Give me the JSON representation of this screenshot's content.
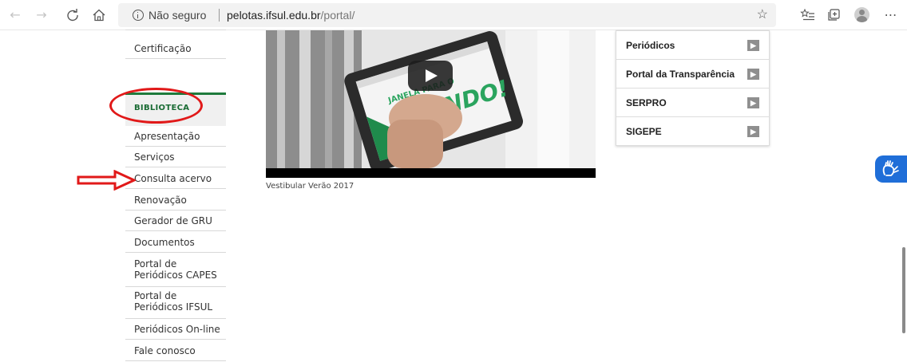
{
  "browser": {
    "security_label": "Não seguro",
    "url_host": "pelotas.ifsul.edu.br",
    "url_path": "/portal/",
    "icons": [
      "back-icon",
      "forward-icon",
      "refresh-icon",
      "home-icon",
      "info-icon",
      "favorite-star-icon",
      "favorites-list-icon",
      "collections-icon",
      "profile-icon",
      "more-icon"
    ]
  },
  "left_menu": {
    "top_items": [
      "Certificação"
    ],
    "section_title": "BIBLIOTECA",
    "items": [
      "Apresentação",
      "Serviços",
      "Consulta acervo",
      "Renovação",
      "Gerador de GRU",
      "Documentos",
      "Portal de Periódicos CAPES",
      "Portal de Periódicos IFSUL",
      "Periódicos On-line",
      "Fale conosco"
    ]
  },
  "video": {
    "caption": "Vestibular Verão 2017",
    "overlay_text_1": "JANELA PARA O",
    "overlay_text_2": "MUNDO!"
  },
  "right_panel": {
    "items": [
      "Periódicos",
      "Portal da Transparência",
      "SERPRO",
      "SIGEPE"
    ]
  },
  "annotation_colors": {
    "highlight": "#e11919",
    "brand_green": "#1e7a3c",
    "accessibility_blue": "#1f6ed8"
  }
}
